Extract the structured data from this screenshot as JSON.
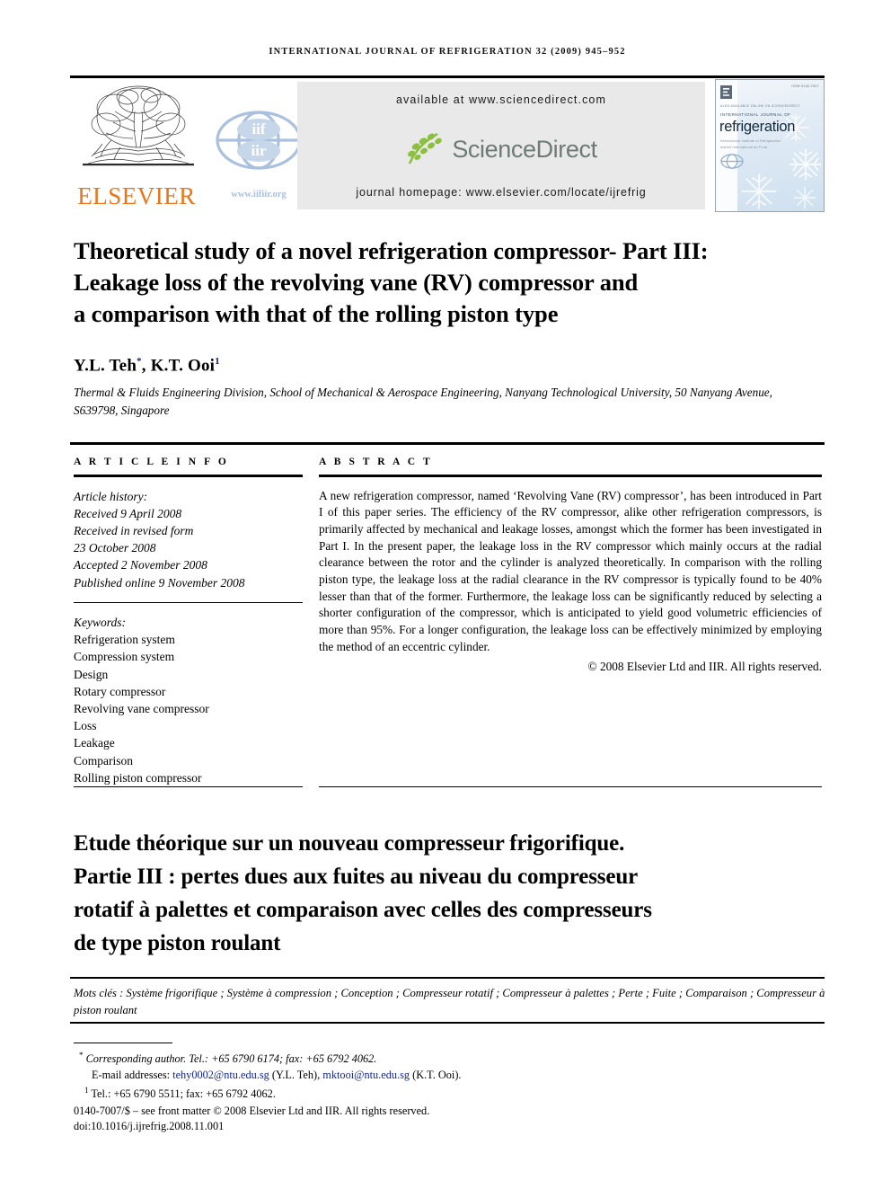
{
  "running_head": "International Journal of Refrigeration 32 (2009) 945–952",
  "masthead": {
    "elsevier_wordmark": "ELSEVIER",
    "elsevier_color": "#E8761A",
    "iif_url": "www.iifiir.org",
    "iif_color": "#A9C0DE",
    "available_at": "available at www.sciencedirect.com",
    "sciencedirect_wordmark": "ScienceDirect",
    "sciencedirect_color": "#6E7B75",
    "journal_homepage": "journal homepage: www.elsevier.com/locate/ijrefrig",
    "band_background": "#E9E9E9",
    "cover": {
      "top_right_code": "ISSN 0140-7007",
      "line1": "ALSO AVAILABLE ONLINE ON SCIENCEDIRECT",
      "line2": "INTERNATIONAL JOURNAL OF",
      "title": "refrigeration",
      "sub1": "International Institute of Refrigeration",
      "sub2": "Institut International du Froid"
    }
  },
  "article": {
    "title_line1": "Theoretical study of a novel refrigeration compressor- Part III:",
    "title_line2": "Leakage loss of the revolving vane (RV) compressor and",
    "title_line3": "a comparison with that of the rolling piston type",
    "authors": "Y.L. Teh",
    "author_marker_1": "*",
    "authors_second": ", K.T. Ooi",
    "author_marker_2": "1",
    "affiliation": "Thermal & Fluids Engineering Division, School of Mechanical & Aerospace Engineering, Nanyang Technological University, 50 Nanyang Avenue, S639798, Singapore"
  },
  "article_info": {
    "heading": "A R T I C L E   I N F O",
    "history_label": "Article history:",
    "history": [
      "Received 9 April 2008",
      "Received in revised form",
      "23 October 2008",
      "Accepted 2 November 2008",
      "Published online 9 November 2008"
    ],
    "keywords_label": "Keywords:",
    "keywords": [
      "Refrigeration system",
      "Compression system",
      "Design",
      "Rotary compressor",
      "Revolving vane compressor",
      "Loss",
      "Leakage",
      "Comparison",
      "Rolling piston compressor"
    ]
  },
  "abstract": {
    "heading": "A B S T R A C T",
    "text": "A new refrigeration compressor, named ‘Revolving Vane (RV) compressor’, has been introduced in Part I of this paper series. The efficiency of the RV compressor, alike other refrigeration compressors, is primarily affected by mechanical and leakage losses, amongst which the former has been investigated in Part I. In the present paper, the leakage loss in the RV compressor which mainly occurs at the radial clearance between the rotor and the cylinder is analyzed theoretically. In comparison with the rolling piston type, the leakage loss at the radial clearance in the RV compressor is typically found to be 40% lesser than that of the former. Furthermore, the leakage loss can be significantly reduced by selecting a shorter configuration of the compressor, which is anticipated to yield good volumetric efficiencies of more than 95%. For a longer configuration, the leakage loss can be effectively minimized by employing the method of an eccentric cylinder.",
    "copyright": "© 2008 Elsevier Ltd and IIR. All rights reserved."
  },
  "french": {
    "title_line1": "Etude théorique sur un nouveau compresseur frigorifique.",
    "title_line2": "Partie III : pertes dues aux fuites au niveau du compresseur",
    "title_line3": "rotatif à palettes et comparaison avec celles des compresseurs",
    "title_line4": "de type piston roulant",
    "keywords": "Mots clés : Système frigorifique ; Système à compression ; Conception ; Compresseur rotatif ; Compresseur à palettes ; Perte ; Fuite ; Comparaison ; Compresseur à piston roulant"
  },
  "footnotes": {
    "corresponding": "Corresponding author. Tel.: +65 6790 6174; fax: +65 6792 4062.",
    "email_label": "E-mail addresses:",
    "email_1": "tehy0002@ntu.edu.sg",
    "email_1_owner": "(Y.L. Teh),",
    "email_2": "mktooi@ntu.edu.sg",
    "email_2_owner": "(K.T. Ooi).",
    "tel_note": "Tel.: +65 6790 5511; fax: +65 6792 4062.",
    "issn_line": "0140-7007/$ – see front matter © 2008 Elsevier Ltd and IIR. All rights reserved.",
    "doi_line": "doi:10.1016/j.ijrefrig.2008.11.001",
    "link_color": "#13259b"
  }
}
